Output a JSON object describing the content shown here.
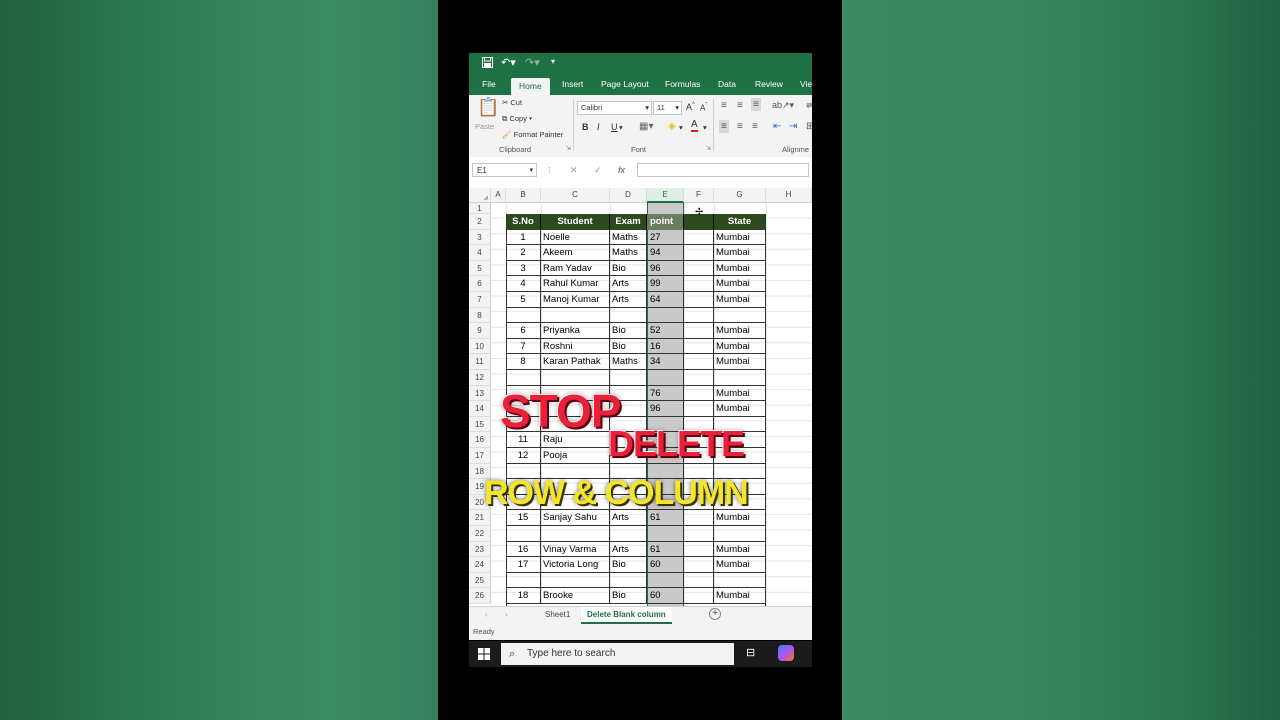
{
  "titlebar": {
    "save_icon": "save-icon",
    "undo_icon": "undo-icon",
    "redo_icon": "redo-icon",
    "customize": "▾"
  },
  "ribbon": {
    "tabs": [
      "File",
      "Home",
      "Insert",
      "Page Layout",
      "Formulas",
      "Data",
      "Review",
      "Vie"
    ],
    "active_tab": "Home",
    "clipboard": {
      "paste": "Paste",
      "cut": "Cut",
      "copy": "Copy",
      "format_painter": "Format Painter",
      "group": "Clipboard"
    },
    "font": {
      "name": "Calibri",
      "size": "11",
      "bold": "B",
      "italic": "I",
      "underline": "U",
      "group": "Font"
    },
    "alignment": {
      "group": "Alignme"
    }
  },
  "formula_bar": {
    "name_box": "E1",
    "cancel": "✕",
    "enter": "✓",
    "fx": "fx",
    "value": ""
  },
  "columns": [
    "A",
    "B",
    "C",
    "D",
    "E",
    "F",
    "G",
    "H"
  ],
  "selected_column": "E",
  "rows": [
    "1",
    "2",
    "3",
    "4",
    "5",
    "6",
    "7",
    "8",
    "9",
    "10",
    "11",
    "12",
    "13",
    "14",
    "15",
    "16",
    "17",
    "18",
    "19",
    "20",
    "21",
    "22",
    "23",
    "24",
    "25",
    "26"
  ],
  "table": {
    "headers": [
      "S.No",
      "Student",
      "Exam",
      "point",
      "",
      "State"
    ],
    "data": [
      {
        "row": 3,
        "sno": "1",
        "student": "Noelle",
        "exam": "Maths",
        "point": "27",
        "state": "Mumbai"
      },
      {
        "row": 4,
        "sno": "2",
        "student": "Akeem",
        "exam": "Maths",
        "point": "94",
        "state": "Mumbai"
      },
      {
        "row": 5,
        "sno": "3",
        "student": "Ram Yadav",
        "exam": "Bio",
        "point": "96",
        "state": "Mumbai"
      },
      {
        "row": 6,
        "sno": "4",
        "student": "Rahul Kumar",
        "exam": "Arts",
        "point": "99",
        "state": "Mumbai"
      },
      {
        "row": 7,
        "sno": "5",
        "student": "Manoj Kumar",
        "exam": "Arts",
        "point": "64",
        "state": "Mumbai"
      },
      {
        "row": 9,
        "sno": "6",
        "student": "Priyanka",
        "exam": "Bio",
        "point": "52",
        "state": "Mumbai"
      },
      {
        "row": 10,
        "sno": "7",
        "student": "Roshni",
        "exam": "Bio",
        "point": "16",
        "state": "Mumbai"
      },
      {
        "row": 11,
        "sno": "8",
        "student": "Karan Pathak",
        "exam": "Maths",
        "point": "34",
        "state": "Mumbai"
      },
      {
        "row": 13,
        "sno": "",
        "student": "",
        "exam": "",
        "point": "76",
        "state": "Mumbai"
      },
      {
        "row": 14,
        "sno": "",
        "student": "",
        "exam": "",
        "point": "96",
        "state": "Mumbai"
      },
      {
        "row": 16,
        "sno": "11",
        "student": "Raju",
        "exam": "",
        "point": "",
        "state": ""
      },
      {
        "row": 17,
        "sno": "12",
        "student": "Pooja",
        "exam": "",
        "point": "",
        "state": ""
      },
      {
        "row": 21,
        "sno": "15",
        "student": "Sanjay Sahu",
        "exam": "Arts",
        "point": "61",
        "state": "Mumbai"
      },
      {
        "row": 23,
        "sno": "16",
        "student": "Vinay Varma",
        "exam": "Arts",
        "point": "61",
        "state": "Mumbai"
      },
      {
        "row": 24,
        "sno": "17",
        "student": "Victoria Long",
        "exam": "Bio",
        "point": "60",
        "state": "Mumbai"
      },
      {
        "row": 26,
        "sno": "18",
        "student": "Brooke",
        "exam": "Bio",
        "point": "60",
        "state": "Mumbai"
      }
    ]
  },
  "sheets": {
    "tabs": [
      "Sheet1",
      "Delete  Blank column"
    ],
    "active": "Delete  Blank column",
    "add": "+"
  },
  "status": "Ready",
  "taskbar": {
    "search_placeholder": "Type here to search"
  },
  "overlay": {
    "line1": "STOP",
    "line2": "DELETE",
    "line3": "ROW & COLUMN"
  },
  "colors": {
    "excel_green": "#1e7145",
    "header_fill": "#2c4a1e",
    "stop_red": "#e8203a",
    "title_yellow": "#f2e62a"
  }
}
